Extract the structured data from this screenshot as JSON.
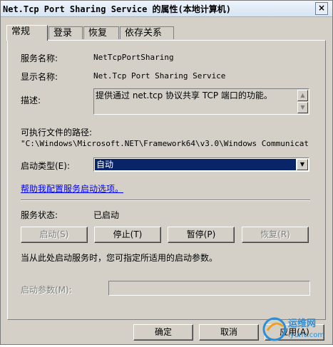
{
  "window": {
    "title": "Net.Tcp Port Sharing Service 的属性(本地计算机)",
    "close_glyph": "×"
  },
  "tabs": [
    {
      "label": "常规"
    },
    {
      "label": "登录"
    },
    {
      "label": "恢复"
    },
    {
      "label": "依存关系"
    }
  ],
  "general": {
    "service_name_label": "服务名称:",
    "service_name": "NetTcpPortSharing",
    "display_name_label": "显示名称:",
    "display_name": "Net.Tcp Port Sharing Service",
    "description_label": "描述:",
    "description": "提供通过 net.tcp 协议共享 TCP 端口的功能。",
    "path_label": "可执行文件的路径:",
    "path": "\"C:\\Windows\\Microsoft.NET\\Framework64\\v3.0\\Windows Communicat",
    "startup_type_label": "启动类型(E):",
    "startup_type": "自动",
    "help_link": "帮助我配置服务启动选项。",
    "status_label": "服务状态:",
    "status": "已启动",
    "buttons": {
      "start": "启动(S)",
      "stop": "停止(T)",
      "pause": "暂停(P)",
      "resume": "恢复(R)"
    },
    "params_hint": "当从此处启动服务时，您可指定所适用的启动参数。",
    "params_label": "启动参数(M):",
    "params_value": ""
  },
  "footer": {
    "ok": "确定",
    "cancel": "取消",
    "apply": "应用(A)"
  },
  "watermark": {
    "text": "运维网",
    "subtext": "iyunv.com",
    "accent": "#2a8fd8"
  }
}
